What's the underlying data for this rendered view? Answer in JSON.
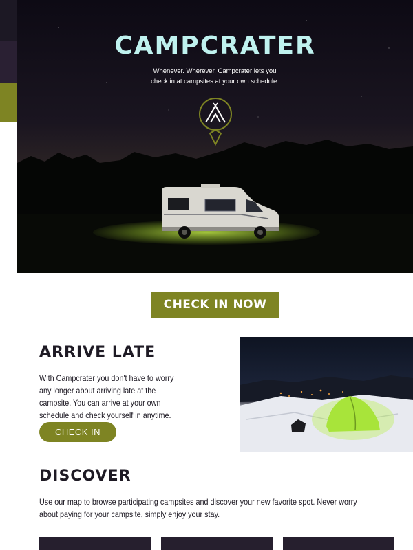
{
  "hero": {
    "title": "CAMPCRATER",
    "tagline": "Whenever. Wherever. Campcrater lets you check in at campsites at your own schedule.",
    "logo_icon": "tent-pin-icon",
    "image": "camper-van-at-night"
  },
  "cta": {
    "label": "CHECK IN NOW"
  },
  "arrive_late": {
    "title": "ARRIVE LATE",
    "text": "With Campcrater you don't have to worry any longer about arriving late at the campsite. You can arrive at your own schedule and check yourself in anytime.",
    "button_label": "CHECK IN",
    "image": "glowing-tent-on-snow"
  },
  "discover": {
    "title": "DISCOVER",
    "text": "Use our map to browse participating campsites and discover your new favorite spot. Never worry about paying for your campsite, simply enjoy your stay."
  },
  "colors": {
    "accent": "#7e8423",
    "dark": "#261f2e",
    "title_cyan": "#bff2ef",
    "text": "#1e1a24"
  }
}
